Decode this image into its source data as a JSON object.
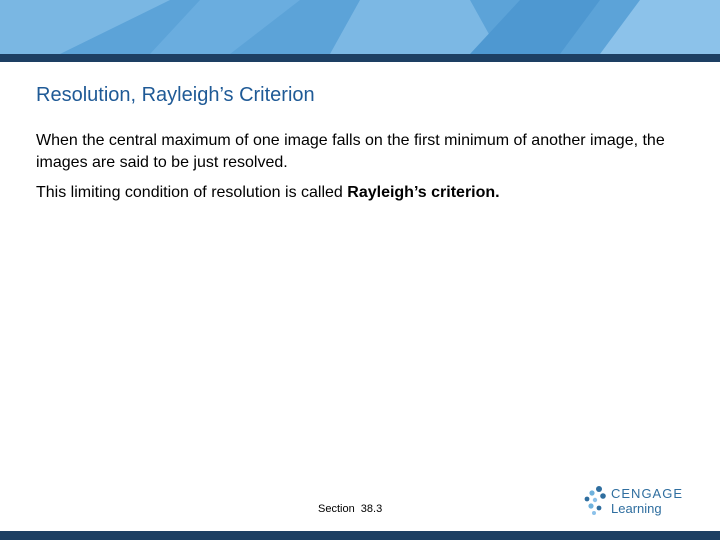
{
  "slide": {
    "title": "Resolution, Rayleigh’s Criterion",
    "paragraphs": {
      "p1": "When the central maximum of one image falls on the first minimum of another image, the images are said to be just resolved.",
      "p2_lead": "This limiting condition of resolution is called ",
      "p2_bold": "Rayleigh’s criterion."
    },
    "footer": "Section  38.3"
  },
  "logo": {
    "line1": "CENGAGE",
    "line2": "Learning"
  },
  "colors": {
    "banner": "#5ca3d8",
    "rule": "#1d3f63",
    "title": "#1f5a96",
    "logo": "#2f6e9f"
  }
}
